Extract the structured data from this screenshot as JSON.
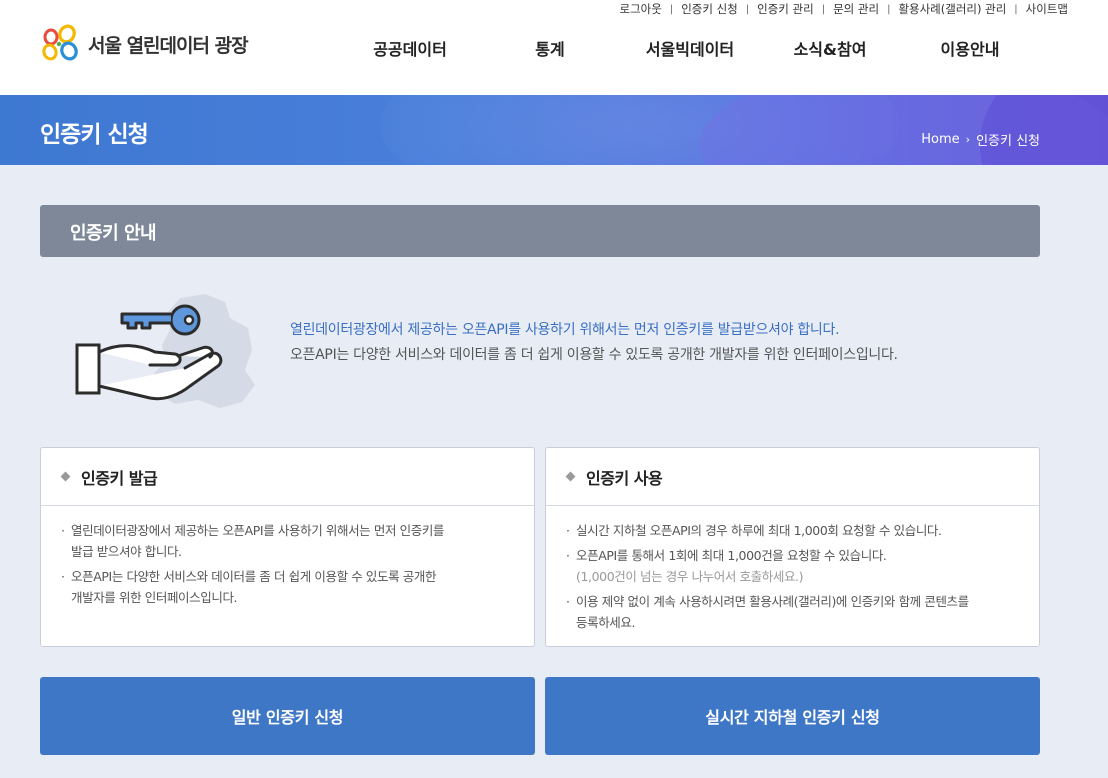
{
  "header": {
    "logo_text": "서울 열린데이터 광장",
    "util_links": [
      "로그아웃",
      "인증키 신청",
      "인증키 관리",
      "문의 관리",
      "활용사례(갤러리) 관리",
      "사이트맵"
    ],
    "gnb": [
      "공공데이터",
      "통계",
      "서울빅데이터",
      "소식&참여",
      "이용안내"
    ]
  },
  "banner": {
    "title": "인증키 신청",
    "breadcrumb": [
      "Home",
      "인증키 신청"
    ]
  },
  "section": {
    "title": "인증키 안내"
  },
  "intro": {
    "line1": "열린데이터광장에서 제공하는 오픈API를 사용하기 위해서는 먼저 인증키를 발급받으셔야 합니다.",
    "line2": "오픈API는 다양한 서비스와 데이터를 좀 더 쉽게 이용할 수 있도록 공개한 개발자를 위한 인터페이스입니다."
  },
  "boxes": {
    "issue": {
      "title": "인증키 발급",
      "b1_l1": "열린데이터광장에서 제공하는 오픈API를 사용하기 위해서는 먼저 인증키를",
      "b1_l2": "발급 받으셔야 합니다.",
      "b2_l1": "오픈API는 다양한 서비스와 데이터를 좀 더 쉽게 이용할 수 있도록 공개한",
      "b2_l2": "개발자를 위한 인터페이스입니다."
    },
    "use": {
      "title": "인증키 사용",
      "b1_l1": "실시간 지하철 오픈API의 경우 하루에 최대 1,000회 요청할 수 있습니다.",
      "b2_l1": "오픈API를 통해서 1회에 최대 1,000건을 요청할 수 있습니다.",
      "b2_sub": "(1,000건이 넘는 경우 나누어서 호출하세요.)",
      "b3_l1": "이용 제약 없이 계속 사용하시려면 활용사례(갤러리)에 인증키와 함께 콘텐츠를",
      "b3_l2": "등록하세요."
    }
  },
  "buttons": {
    "general": "일반 인증키 신청",
    "subway": "실시간 지하철 인증키 신청"
  },
  "colors": {
    "banner": "#4a7fdb",
    "section_bar": "#7e8899",
    "cta": "#3f77c7",
    "intro_highlight": "#3a6fc4",
    "page_bg": "#e8edf5"
  }
}
